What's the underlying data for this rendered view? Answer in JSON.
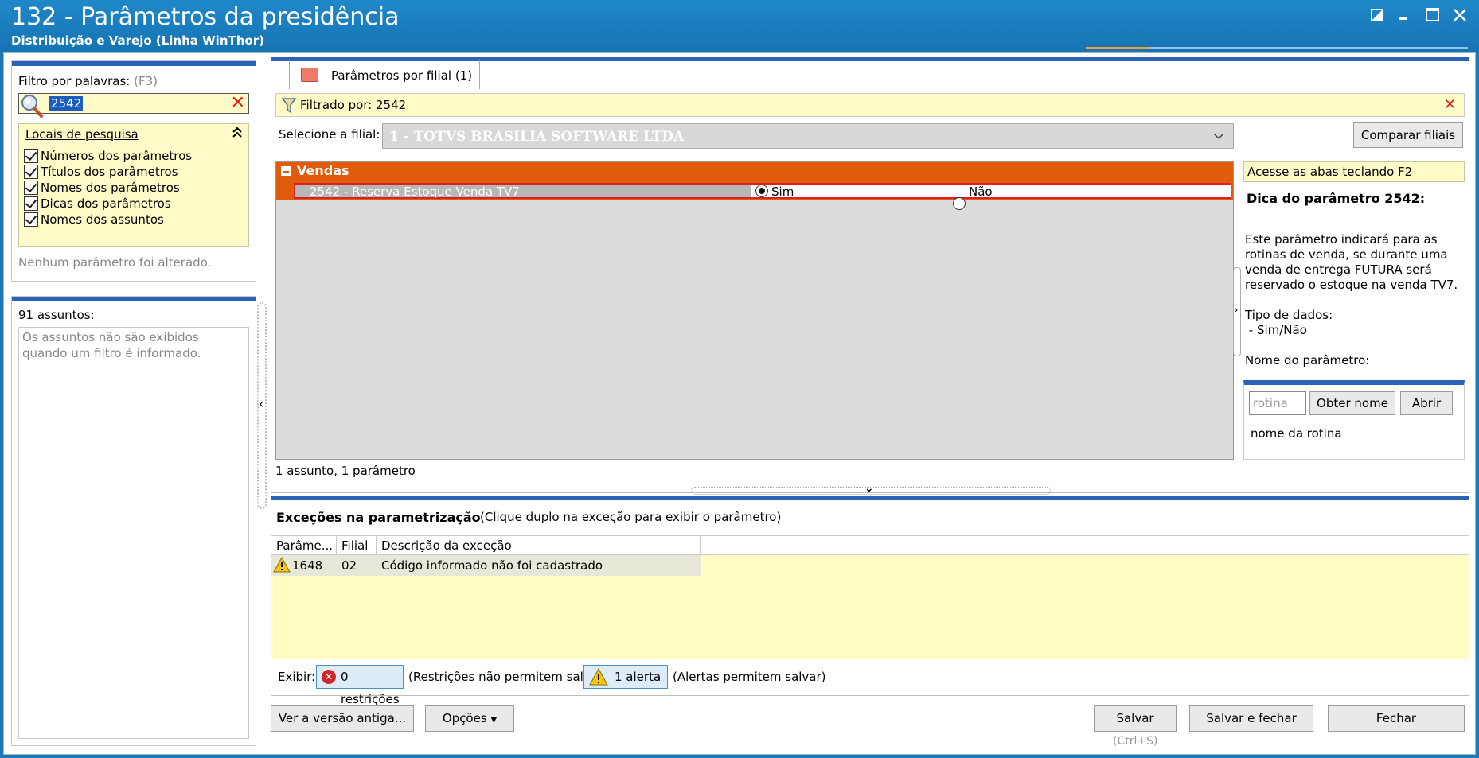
{
  "window": {
    "title": "132 - Parâmetros da presidência",
    "subtitle": "Distribuição e Varejo (Linha WinThor)",
    "controls": [
      "restore-icon",
      "minimize-icon",
      "maximize-icon",
      "close-icon"
    ]
  },
  "filter": {
    "label": "Filtro por palavras:",
    "shortcut": "(F3)",
    "search_value": "2542",
    "locations_title": "Locais de pesquisa",
    "locations": [
      {
        "label": "Números dos parâmetros",
        "checked": true
      },
      {
        "label": "Títulos dos parâmetros",
        "checked": true
      },
      {
        "label": "Nomes dos parâmetros",
        "checked": true
      },
      {
        "label": "Dicas dos parâmetros",
        "checked": true
      },
      {
        "label": "Nomes dos assuntos",
        "checked": true
      }
    ],
    "no_change": "Nenhum parâmetro foi alterado."
  },
  "subjects": {
    "count_label": "91 assuntos:",
    "message": "Os assuntos não são exibidos quando um filtro é informado."
  },
  "tab": {
    "label": "Parâmetros por filial",
    "count": "(1)"
  },
  "filtered_by": "Filtrado por: 2542",
  "filial": {
    "label": "Selecione a filial:",
    "value": "1 - TOTVS BRASILIA SOFTWARE LTDA",
    "compare_button": "Comparar filiais"
  },
  "grid": {
    "group": "Vendas",
    "param": "2542 - Reserva Estoque Venda TV7",
    "option_yes": "Sim",
    "option_no": "Não",
    "selected": "Sim",
    "status": "1 assunto, 1 parâmetro"
  },
  "hint": {
    "bar": "Acesse as abas teclando F2",
    "title": "Dica do parâmetro 2542:",
    "paragraphs": [
      "Este parâmetro indicará para as rotinas de venda, se durante uma venda de entrega FUTURA será reservado o estoque na venda TV7.",
      "Tipo de dados:\n - Sim/Não",
      "Nome do parâmetro:"
    ]
  },
  "rotina": {
    "placeholder": "rotina",
    "obter_button": "Obter nome",
    "abrir_button": "Abrir",
    "name_label": "nome da rotina"
  },
  "exceptions": {
    "title": "Exceções na parametrização",
    "hint": "(Clique duplo na exceção para exibir o parâmetro)",
    "columns": [
      "Parâme...",
      "Filial",
      "Descrição da exceção"
    ],
    "rows": [
      {
        "param": "1648",
        "filial": "02",
        "descricao": "Código informado não foi cadastrado"
      }
    ],
    "show_label": "Exibir:",
    "restrictions_button": "0 restrições",
    "restrictions_note": "(Restrições não permitem salvar)",
    "alerts_button": "1 alerta",
    "alerts_note": "(Alertas permitem salvar)"
  },
  "footer": {
    "old_version_button": "Ver a versão antiga...",
    "options_button": "Opções",
    "save_button": "Salvar",
    "save_shortcut": "(Ctrl+S)",
    "save_close_button": "Salvar e fechar",
    "close_button": "Fechar"
  },
  "colors": {
    "titlebar": "#1b78b9",
    "accent": "#2b64b6",
    "group": "#e05b0c",
    "highlight": "#fffbc8",
    "error": "#e02020"
  }
}
